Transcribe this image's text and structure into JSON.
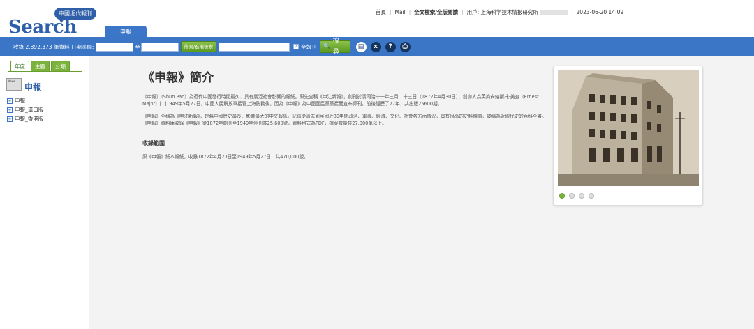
{
  "header": {
    "logo_text": "Search",
    "logo_badge": "中國近代報刊",
    "tab_label": "申報",
    "links": [
      "首頁",
      "Mail",
      "全文檢索/全版閱讀"
    ],
    "user_label": "用戶: 上海科学技术情报研究所",
    "datetime": "2023-06-20 14:09"
  },
  "searchbar": {
    "count_label": "收錄 2,892,373 筆資料 日期區間:",
    "to_label": "至",
    "mode_button": "簡易/進階檢索",
    "fulltext_label": "全報刊",
    "search_button": "搜 尋"
  },
  "sidebar": {
    "tabs": [
      "年度",
      "主題",
      "分類"
    ],
    "news_icon_text": "News",
    "title": "申報",
    "items": [
      "申報",
      "申報_漢口版",
      "申報_香港版"
    ]
  },
  "main": {
    "title": "《申報》簡介",
    "para1": "《申報》（Shun Pao）為近代中國發行時間最久、具有廣泛社會影響的報紙。原先全稱《申江新報》，創刊於清同治十一年三月二十三日（1872年4月30日），創辦人為英商安納斯托·美查（Ernest Major）[1]1949年5月27日，中國人民解放軍接管上海防務後，因為《申報》為中國國民黨黨產而宣布停刊。前後經歷了77年，共出版25600期。",
    "para2": "《申報》全稱為《申江新報》，是舊中國歷史最長、影響最大的中文報紙。記錄從清末到民國近80年間政治、軍事、經濟、文化、社會各方面情況，具有很高的史料價值，被稱為近現代史的百科全書。《申報》資料庫收錄《申報》從1872年創刊至1949年停刊共25,600號，資料格式為PDF，檔案數量共27,000萬以上。",
    "section_title": "收錄範圍",
    "para3": "原《申報》紙本報紙，收錄1872年4月23日至1949年5月27日，共470,000版。"
  }
}
